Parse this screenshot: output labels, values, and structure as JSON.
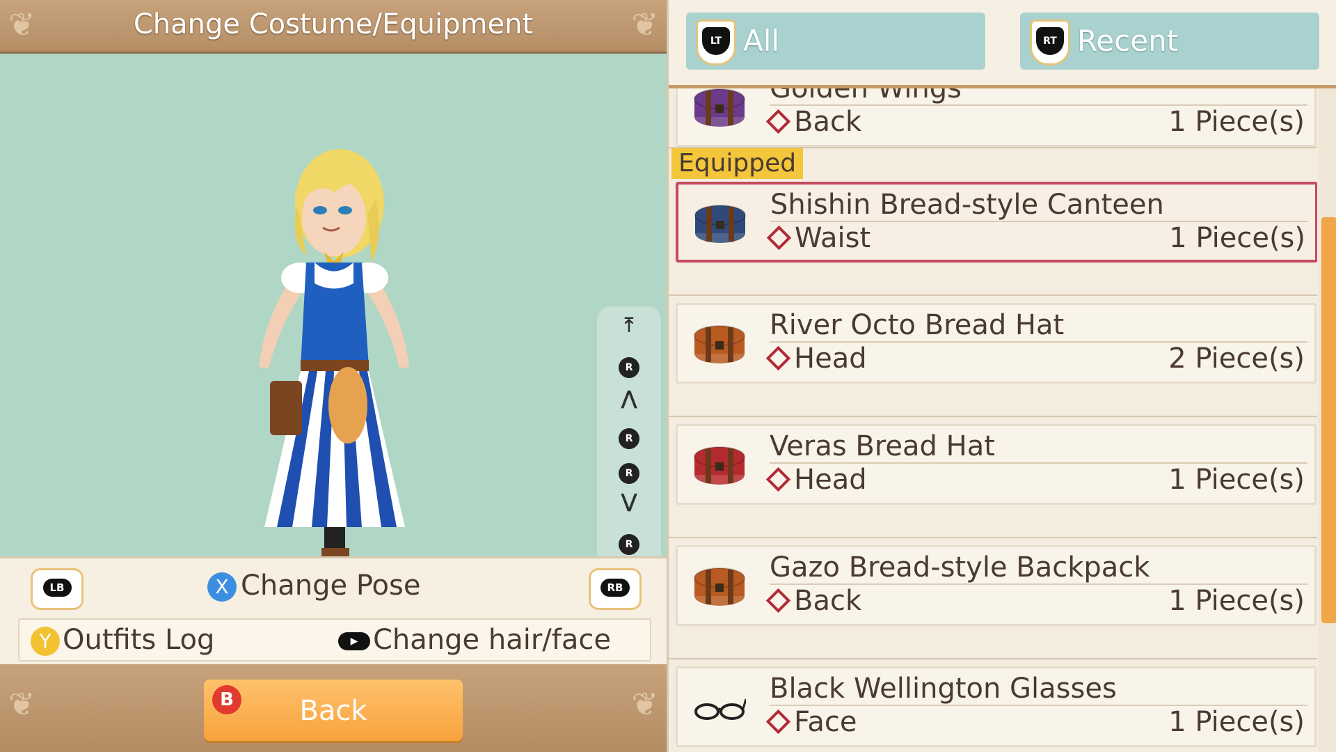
{
  "left": {
    "title": "Change Costume/Equipment",
    "pose_controls": [
      "⤒",
      "R",
      "⋀",
      "R",
      "R",
      "⋁",
      "R",
      "⤓"
    ],
    "lb_label": "LB",
    "rb_label": "RB",
    "x_glyph": "X",
    "change_pose": "Change Pose",
    "y_glyph": "Y",
    "outfits_log": "Outfits Log",
    "change_hair_face": "Change hair/face",
    "back_glyph": "B",
    "back_label": "Back"
  },
  "right": {
    "tabs": [
      {
        "badge": "LT",
        "label": "All"
      },
      {
        "badge": "RT",
        "label": "Recent"
      }
    ],
    "equipped_label": "Equipped",
    "items": [
      {
        "name": "Golden Wings",
        "slot": "Back",
        "qty": "1 Piece(s)",
        "color": "#6b3a8a"
      },
      {
        "name": "Shishin Bread-style Canteen",
        "slot": "Waist",
        "qty": "1 Piece(s)",
        "color": "#2f4a7a"
      },
      {
        "name": "River Octo Bread Hat",
        "slot": "Head",
        "qty": "2 Piece(s)",
        "color": "#b85a22"
      },
      {
        "name": "Veras Bread Hat",
        "slot": "Head",
        "qty": "1 Piece(s)",
        "color": "#b52a2f"
      },
      {
        "name": "Gazo Bread-style Backpack",
        "slot": "Back",
        "qty": "1 Piece(s)",
        "color": "#b85a22"
      },
      {
        "name": "Black Wellington Glasses",
        "slot": "Face",
        "qty": "1 Piece(s)",
        "color": "#222222"
      }
    ]
  },
  "colors": {
    "stage_bg": "#b0d6c6",
    "selected_border": "#c44a5e",
    "equipped_tag": "#f3c63b",
    "scroll_thumb": "#f2a64a"
  }
}
